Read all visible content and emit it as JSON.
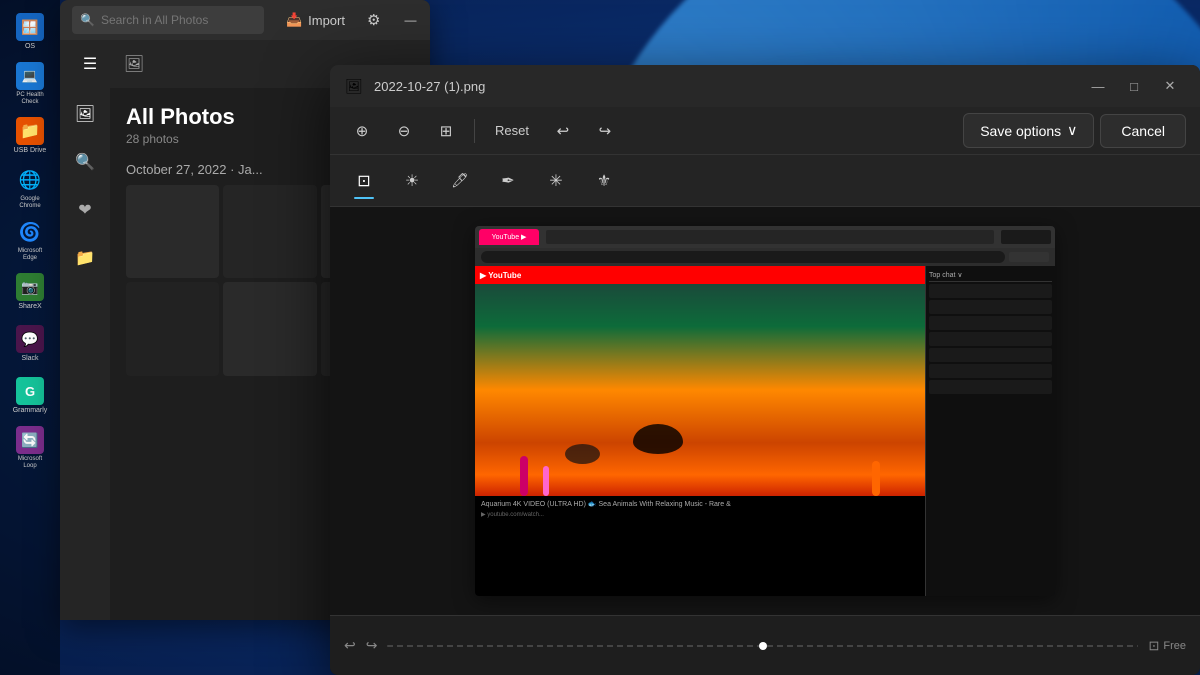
{
  "wallpaper": {
    "alt": "Windows 11 blue wave wallpaper"
  },
  "taskbar": {
    "icons": [
      {
        "id": "os-icon",
        "label": "OS",
        "glyph": "🪟",
        "color": "#4fc3f7"
      },
      {
        "id": "pc-health-icon",
        "label": "PC Health\nCheck",
        "glyph": "💻",
        "color": "#2196f3"
      },
      {
        "id": "usb-drive-icon",
        "label": "USB Drive",
        "glyph": "📁",
        "color": "#ffa726"
      },
      {
        "id": "google-chrome-icon",
        "label": "Google\nChrome",
        "glyph": "🌐",
        "color": "#4caf50"
      },
      {
        "id": "microsoft-edge-icon",
        "label": "Microsoft\nEdge",
        "glyph": "🌀",
        "color": "#1e88e5"
      },
      {
        "id": "sharex-icon",
        "label": "ShareX",
        "glyph": "📷",
        "color": "#43a047"
      },
      {
        "id": "slack-icon",
        "label": "Slack",
        "glyph": "💬",
        "color": "#e91e63"
      },
      {
        "id": "grammarly-icon",
        "label": "Grammarly",
        "glyph": "G",
        "color": "#66bb6a"
      },
      {
        "id": "microsoft-loop-icon",
        "label": "Microsoft\nLoop",
        "glyph": "🔄",
        "color": "#ab47bc"
      }
    ]
  },
  "photos_window": {
    "search_placeholder": "Search in All Photos",
    "title": "All Photos",
    "count": "28 photos",
    "date_header": "October 27, 2022 · Ja...",
    "toolbar": {
      "import_label": "Import",
      "settings_icon": "⚙",
      "minimize": "—",
      "maximize": "□",
      "close": "✕"
    },
    "sidebar_icons": [
      "☰",
      "🔍",
      "❤",
      "📁"
    ]
  },
  "editor_window": {
    "filename": "2022-10-27 (1).png",
    "titlebar": {
      "minimize": "—",
      "maximize": "□",
      "close": "✕"
    },
    "top_toolbar": {
      "zoom_in": "⊕",
      "zoom_out": "⊖",
      "fit_view": "⊞",
      "reset_label": "Reset",
      "undo": "↩",
      "redo": "↪"
    },
    "tools": {
      "crop": {
        "icon": "⊡",
        "label": "Crop",
        "active": true
      },
      "brightness": {
        "icon": "☀",
        "label": "Brightness"
      },
      "eraser": {
        "icon": "✏",
        "label": "Eraser"
      },
      "pen": {
        "icon": "✒",
        "label": "Pen"
      },
      "effects": {
        "icon": "✳",
        "label": "Effects"
      },
      "more": {
        "icon": "⚜",
        "label": "More"
      }
    },
    "save_options_label": "Save options",
    "cancel_label": "Cancel",
    "expand_icon": "⤢",
    "filmstrip": {
      "label": "Free",
      "undo_icon": "↩",
      "redo_icon": "↪"
    }
  },
  "inner_screenshot": {
    "title": "YouTube - Aquarium 4K VIDEO",
    "description": "Colorful Sea Life Video"
  }
}
